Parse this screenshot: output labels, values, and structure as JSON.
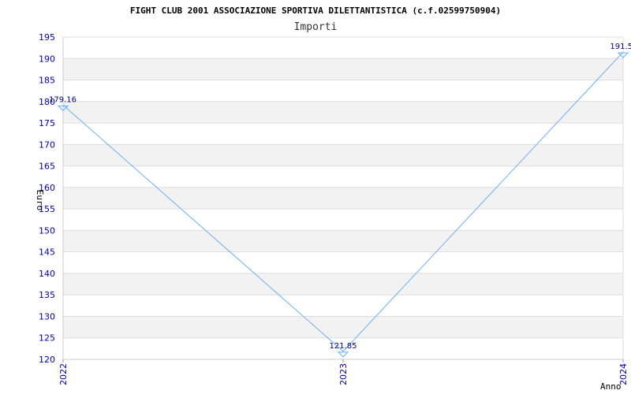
{
  "chart_data": {
    "type": "line",
    "title": "FIGHT CLUB 2001 ASSOCIAZIONE SPORTIVA DILETTANTISTICA (c.f.02599750904)",
    "subtitle": "Importi",
    "xlabel": "Anno",
    "ylabel": "Euro",
    "categories": [
      "2022",
      "2023",
      "2024"
    ],
    "series": [
      {
        "values": [
          179.16,
          121.85,
          191.5
        ]
      }
    ],
    "data_labels": [
      "179.16",
      "121.85",
      "191.5"
    ],
    "ylim": [
      120,
      195
    ],
    "yticks": [
      120,
      125,
      130,
      135,
      140,
      145,
      150,
      155,
      160,
      165,
      170,
      175,
      180,
      185,
      190,
      195
    ],
    "grid": true,
    "colors": {
      "line": "#6aaef0",
      "band": "#f2f2f2",
      "grid": "#dddddd",
      "tick_text": "#0000aa",
      "data_label_text": "#000080"
    }
  }
}
